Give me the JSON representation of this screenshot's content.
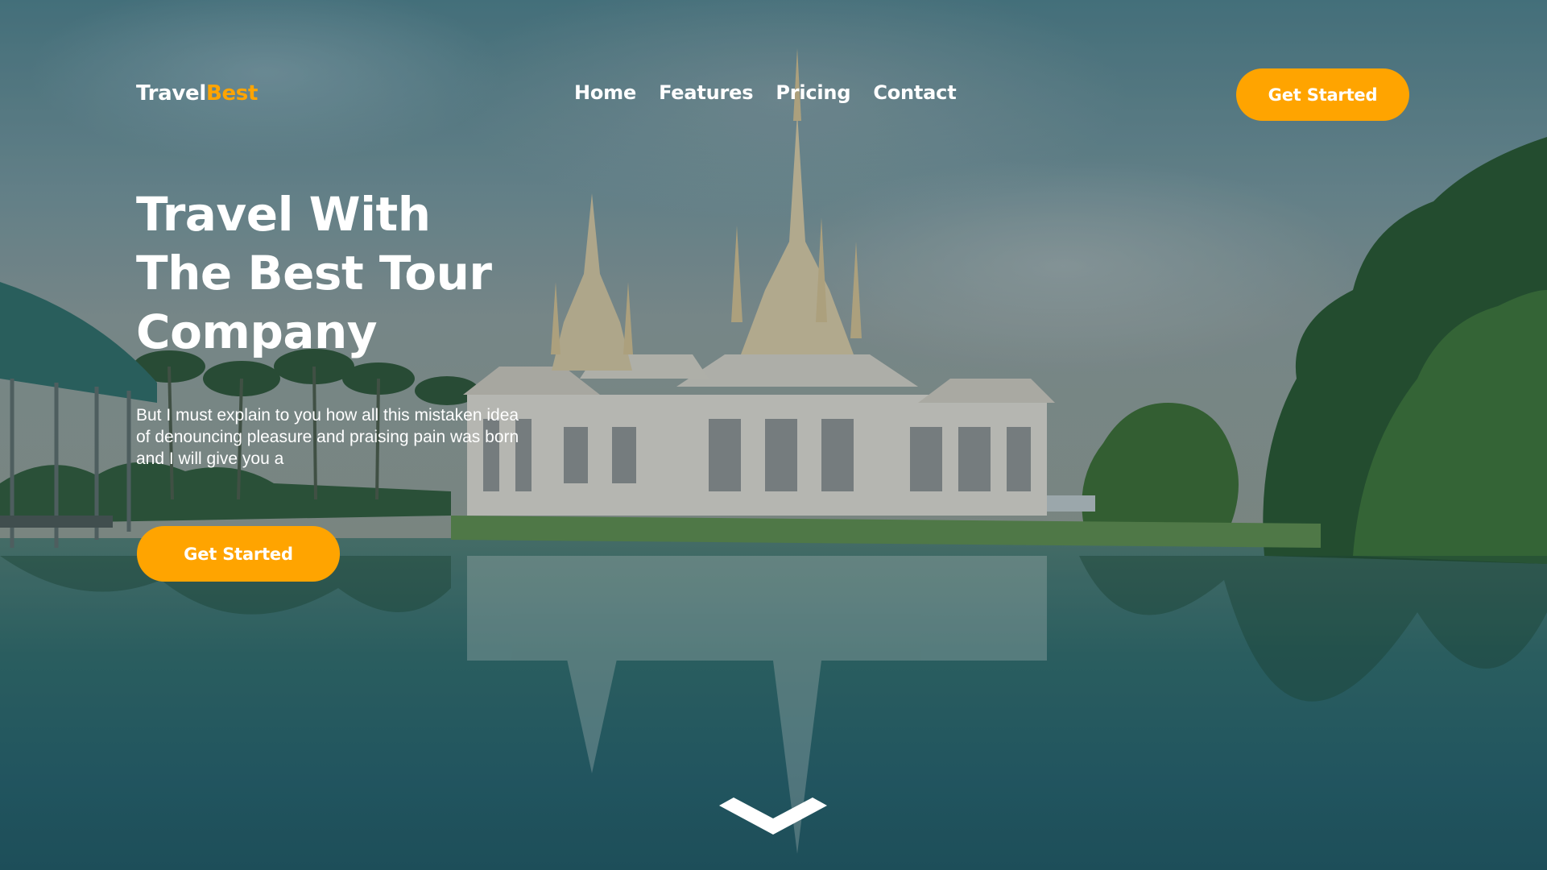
{
  "brand": {
    "part1": "Travel",
    "part2": "Best",
    "accent_color": "#ffa400"
  },
  "nav": {
    "items": [
      {
        "label": "Home"
      },
      {
        "label": "Features"
      },
      {
        "label": "Pricing"
      },
      {
        "label": "Contact"
      }
    ]
  },
  "header_cta": {
    "label": "Get Started"
  },
  "hero": {
    "title_line1": "Travel With",
    "title_line2": "The Best Tour",
    "title_line3": "Company",
    "description": "But I must explain to you how all this mistaken idea of denouncing pleasure and praising pain was born and I will give you a",
    "cta_label": "Get Started"
  },
  "scroll_indicator": {
    "icon": "chevron-down-icon"
  },
  "background": {
    "icon": "temple-lake-photo"
  },
  "colors": {
    "accent": "#ffa400",
    "text": "#ffffff"
  }
}
